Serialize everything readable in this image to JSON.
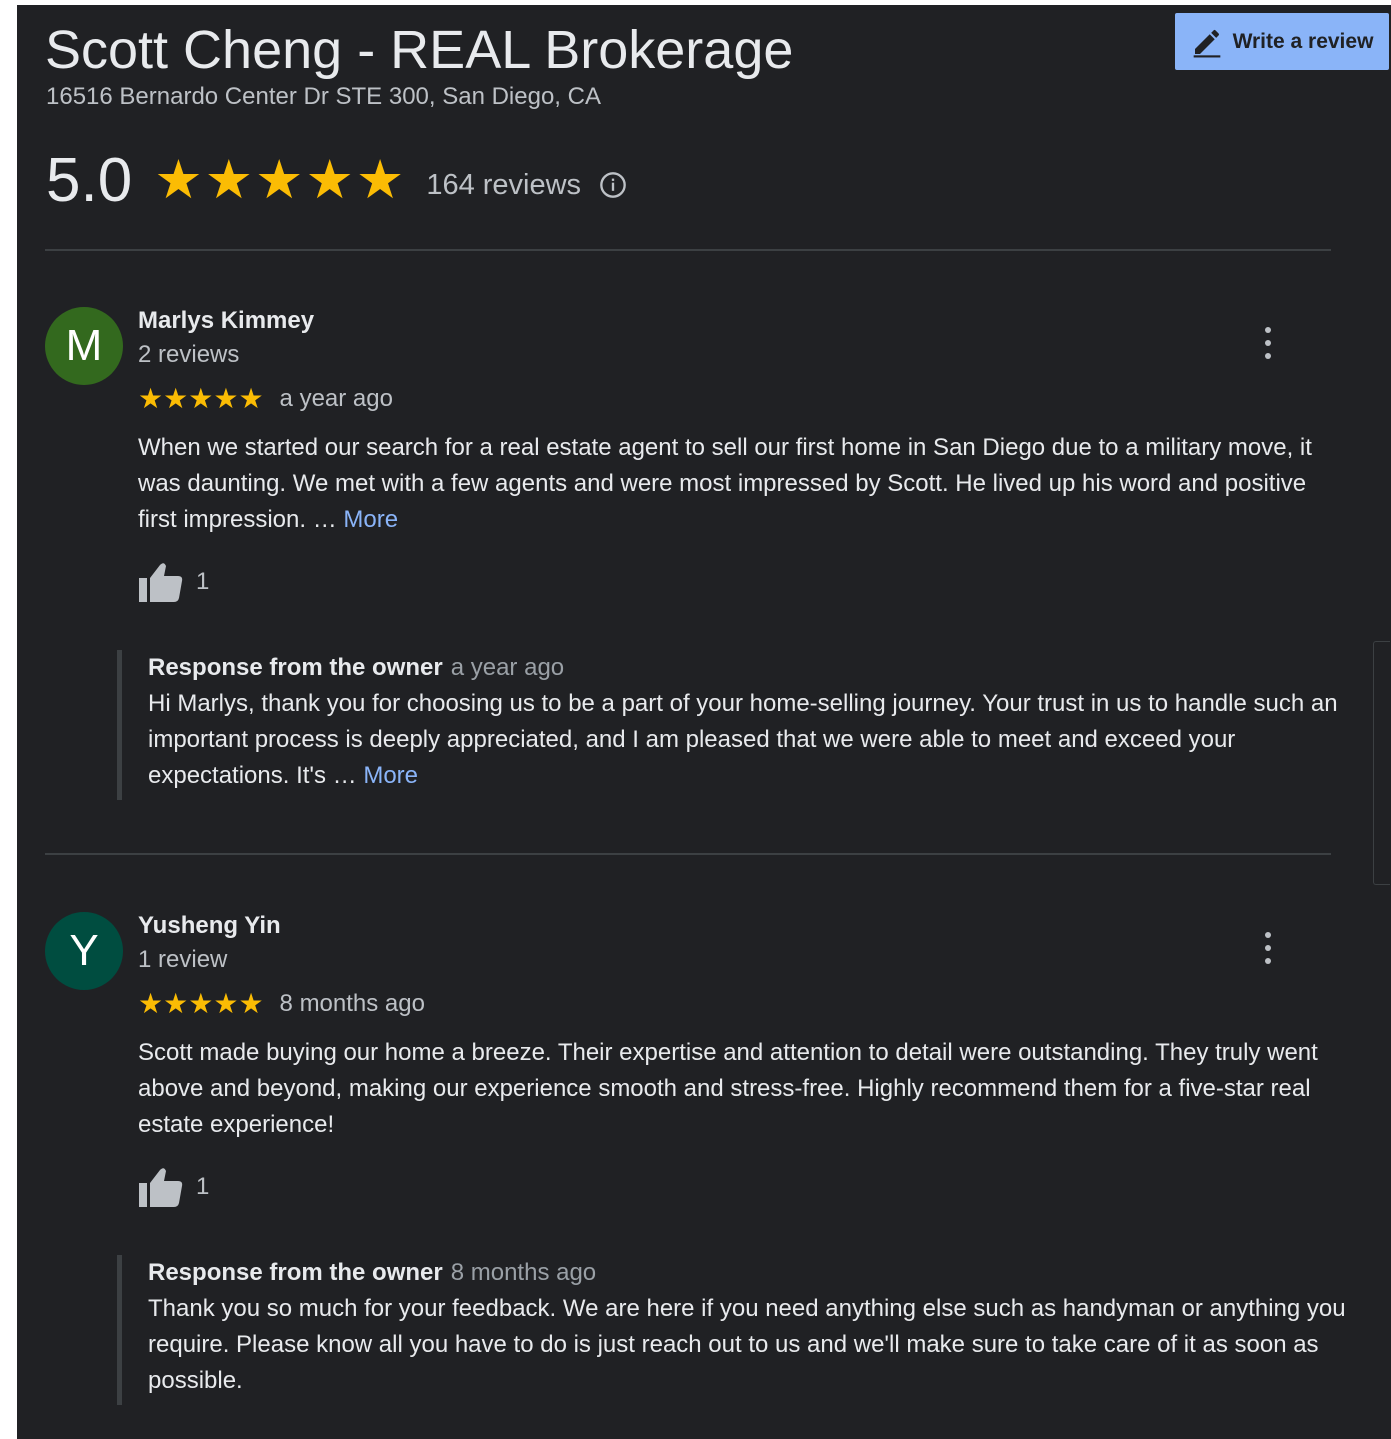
{
  "business": {
    "name": "Scott Cheng - REAL Brokerage",
    "address": "16516 Bernardo Center Dr STE 300, San Diego, CA",
    "rating": "5.0",
    "stars": 5,
    "review_count": "164 reviews"
  },
  "toolbar": {
    "write_review_label": "Write a review"
  },
  "colors": {
    "background": "#202124",
    "star": "#fbbc04",
    "link": "#8ab4f8",
    "button": "#8ab4f8"
  },
  "reviews": [
    {
      "initial": "M",
      "avatar_color": "#33691e",
      "name": "Marlys Kimmey",
      "meta": "2 reviews",
      "stars": 5,
      "date": "a year ago",
      "text": "When we started our search for a real estate agent to sell our first home in San Diego due to a military move, it was daunting. We met with a few agents and were most impressed by Scott. He lived up his word and positive first impression. … ",
      "more": "More",
      "likes": "1",
      "owner_response": {
        "label": "Response from the owner",
        "date": "a year ago",
        "text": "Hi Marlys, thank you for choosing us to be a part of your home-selling journey. Your trust in us to handle such an important process is deeply appreciated, and I am pleased that we were able to meet and exceed your expectations. It's … ",
        "more": "More"
      }
    },
    {
      "initial": "Y",
      "avatar_color": "#004d40",
      "name": "Yusheng Yin",
      "meta": "1 review",
      "stars": 5,
      "date": "8 months ago",
      "text": "Scott made buying our home a breeze. Their expertise and attention to detail were outstanding. They truly went above and beyond, making our experience smooth and stress-free. Highly recommend them for a five-star real estate experience!",
      "likes": "1",
      "owner_response": {
        "label": "Response from the owner",
        "date": "8 months ago",
        "text": "Thank you so much for your feedback. We are here if you need anything else such as handyman or anything you require. Please know all you have to do is just reach out to us and we'll make sure to take care of it as soon as possible."
      }
    }
  ]
}
